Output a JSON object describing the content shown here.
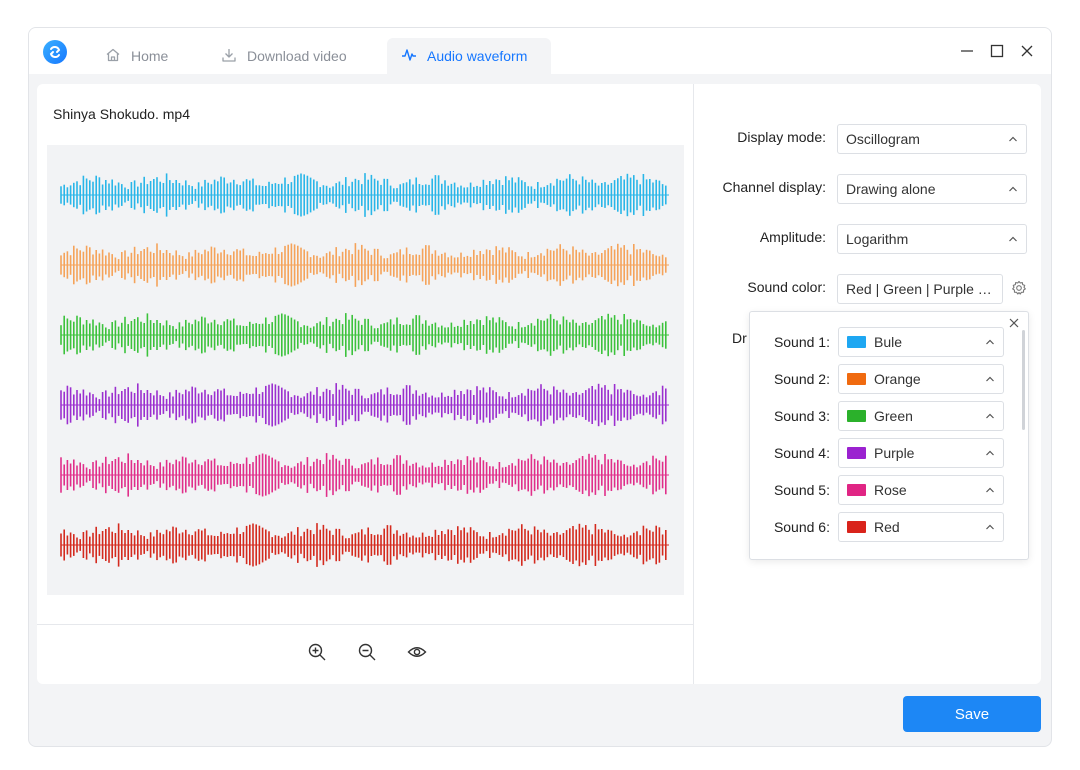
{
  "tabs": [
    {
      "label": "Home",
      "icon": "home-icon"
    },
    {
      "label": "Download video",
      "icon": "download-icon"
    },
    {
      "label": "Audio waveform",
      "icon": "waveform-icon"
    }
  ],
  "active_tab": "Audio waveform",
  "file_name": "Shinya Shokudo. mp4",
  "waveforms": [
    {
      "name": "Sound 1",
      "color": "#29b6e8"
    },
    {
      "name": "Sound 2",
      "color": "#f5a35a"
    },
    {
      "name": "Sound 3",
      "color": "#3cc23c"
    },
    {
      "name": "Sound 4",
      "color": "#9b2fcf"
    },
    {
      "name": "Sound 5",
      "color": "#e02f8a"
    },
    {
      "name": "Sound 6",
      "color": "#d42a1e"
    }
  ],
  "settings": {
    "display_mode": {
      "label": "Display mode:",
      "value": "Oscillogram"
    },
    "channel_display": {
      "label": "Channel display:",
      "value": "Drawing alone"
    },
    "amplitude": {
      "label": "Amplitude:",
      "value": "Logarithm"
    },
    "sound_color": {
      "label": "Sound color:",
      "value": "Red | Green | Purple | R..."
    },
    "partial_label": "Dr"
  },
  "sound_colors": [
    {
      "label": "Sound 1:",
      "value": "Bule",
      "color": "#1ea7f2"
    },
    {
      "label": "Sound 2:",
      "value": "Orange",
      "color": "#f06a0f"
    },
    {
      "label": "Sound 3:",
      "value": "Green",
      "color": "#2bb12b"
    },
    {
      "label": "Sound 4:",
      "value": "Purple",
      "color": "#9b22d0"
    },
    {
      "label": "Sound 5:",
      "value": "Rose",
      "color": "#e02584"
    },
    {
      "label": "Sound 6:",
      "value": "Red",
      "color": "#d9231b"
    }
  ],
  "save_label": "Save",
  "colors": {
    "accent": "#1677ff",
    "save_button": "#1d87f5"
  }
}
